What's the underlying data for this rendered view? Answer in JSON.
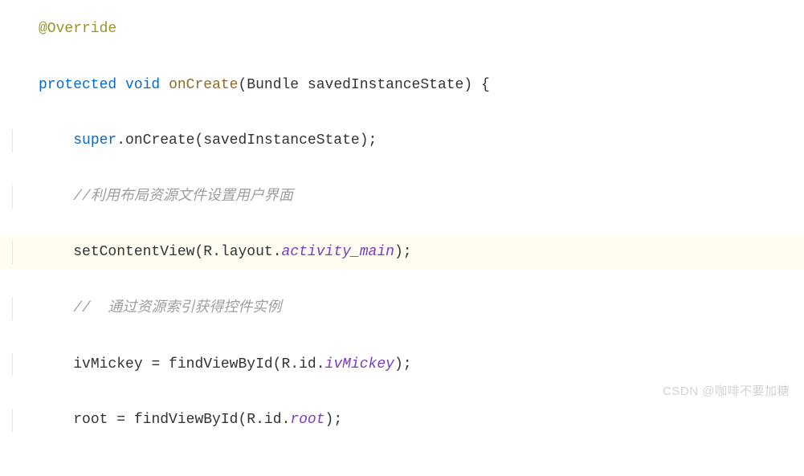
{
  "code": {
    "line1": {
      "annotation": "@Override"
    },
    "line2": {
      "kw_protected": "protected",
      "kw_void": "void",
      "method": "onCreate",
      "paren_open": "(",
      "param_type": "Bundle",
      "param_name": "savedInstanceState",
      "paren_close": ")",
      "brace": " {"
    },
    "line3": {
      "kw_super": "super",
      "dot": ".",
      "call": "onCreate",
      "paren_open": "(",
      "arg": "savedInstanceState",
      "paren_close": ")",
      "semi": ";"
    },
    "line4": {
      "comment": "//利用布局资源文件设置用户界面"
    },
    "line5": {
      "call": "setContentView",
      "paren_open": "(",
      "r": "R",
      "dot1": ".",
      "layout": "layout",
      "dot2": ".",
      "field": "activity_main",
      "paren_close": ")",
      "semi": ";"
    },
    "line6": {
      "comment": "//  通过资源索引获得控件实例"
    },
    "line7": {
      "lhs": "ivMickey",
      "eq": " = ",
      "call": "findViewById",
      "paren_open": "(",
      "r": "R",
      "dot1": ".",
      "id": "id",
      "dot2": ".",
      "field": "ivMickey",
      "paren_close": ")",
      "semi": ";"
    },
    "line8": {
      "lhs": "root",
      "eq": " = ",
      "call": "findViewById",
      "paren_open": "(",
      "r": "R",
      "dot1": ".",
      "id": "id",
      "dot2": ".",
      "field": "root",
      "paren_close": ")",
      "semi": ";"
    }
  },
  "watermark": "CSDN @咖啡不要加糖"
}
